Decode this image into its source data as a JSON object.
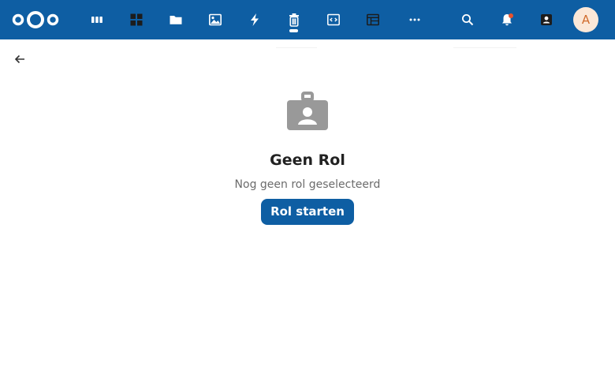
{
  "header": {
    "brand_color": "#0e5ea3",
    "logo_icon": "nextcloud-logo",
    "apps": [
      {
        "name": "stack-app",
        "icon": "stack-icon"
      },
      {
        "name": "dashboard-app",
        "icon": "dashboard-grid-icon"
      },
      {
        "name": "files-app",
        "icon": "folder-icon"
      },
      {
        "name": "photos-app",
        "icon": "image-icon"
      },
      {
        "name": "activity-app",
        "icon": "lightning-icon"
      },
      {
        "name": "trash-app",
        "icon": "trash-icon",
        "active": true
      },
      {
        "name": "code-app",
        "icon": "code-window-icon"
      },
      {
        "name": "tables-app",
        "icon": "table-icon"
      },
      {
        "name": "more-apps",
        "icon": "more-dots-icon"
      }
    ],
    "right_icons": [
      "search-icon",
      "bell-icon",
      "contacts-icon"
    ],
    "notification_dot_color": "#e9522c",
    "avatar_initial": "A"
  },
  "main": {
    "back_icon": "arrow-left-icon",
    "empty_state": {
      "icon": "id-badge-icon",
      "title": "Geen Rol",
      "description": "Nog geen rol geselecteerd",
      "button_label": "Rol starten"
    }
  }
}
